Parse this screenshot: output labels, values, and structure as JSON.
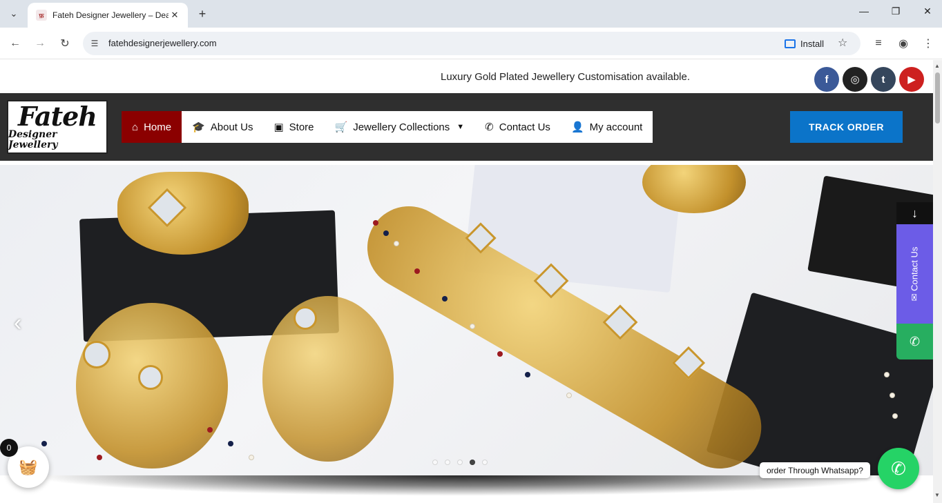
{
  "browser": {
    "tab_title": "Fateh Designer Jewellery – Deal",
    "favicon_text": "फ़",
    "url": "fatehdesignerjewellery.com",
    "install_label": "Install"
  },
  "site": {
    "announcement": "Luxury Gold Plated Jewellery Customisation available.",
    "social": [
      {
        "name": "facebook-icon",
        "glyph": "f",
        "color": "#3b5998"
      },
      {
        "name": "instagram-icon",
        "glyph": "◎",
        "color": "#222222"
      },
      {
        "name": "tumblr-icon",
        "glyph": "t",
        "color": "#35465c"
      },
      {
        "name": "youtube-icon",
        "glyph": "▶",
        "color": "#cd201f"
      }
    ],
    "logo": {
      "line1": "Fateh",
      "line2": "Designer Jewellery"
    },
    "menu": [
      {
        "label": "Home",
        "icon": "home-icon",
        "glyph": "⌂",
        "active": true
      },
      {
        "label": "About Us",
        "icon": "graduation-cap-icon",
        "glyph": "🎓"
      },
      {
        "label": "Store",
        "icon": "store-icon",
        "glyph": "▣"
      },
      {
        "label": "Jewellery Collections",
        "icon": "cart-icon",
        "glyph": "🛒",
        "dropdown": true
      },
      {
        "label": "Contact Us",
        "icon": "phone-icon",
        "glyph": "✆"
      },
      {
        "label": "My account",
        "icon": "user-icon",
        "glyph": "👤"
      }
    ],
    "track_order": "TRACK ORDER",
    "slider": {
      "prev_glyph": "‹",
      "dot_count": 5,
      "active_dot": 4
    },
    "scroll_down_glyph": "↓",
    "contact_tab": "✉ Contact Us",
    "phone_glyph": "✆",
    "cart_count": "0",
    "whatsapp_label": "order Through Whatsapp?"
  },
  "colors": {
    "nav_bg": "#2f2f2f",
    "active_menu": "#8b0000",
    "track_btn": "#0b74c9",
    "contact_tab": "#6c5ce7",
    "phone_tab": "#27ae60",
    "whatsapp": "#25d366"
  }
}
